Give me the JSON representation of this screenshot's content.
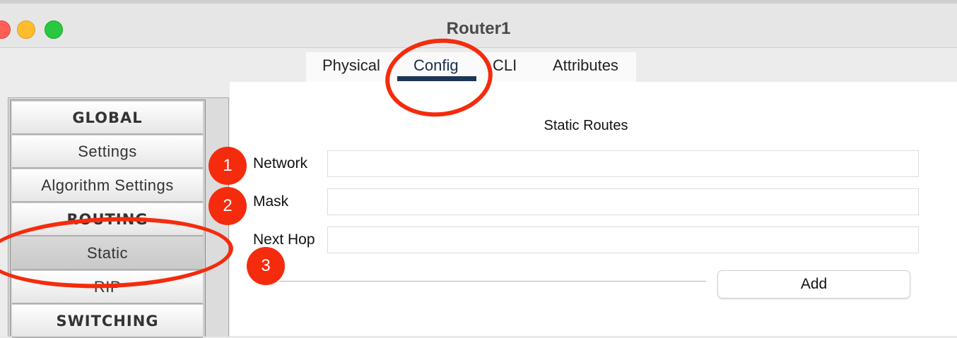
{
  "window": {
    "title": "Router1"
  },
  "tabs": [
    {
      "label": "Physical"
    },
    {
      "label": "Config"
    },
    {
      "label": "CLI"
    },
    {
      "label": "Attributes"
    }
  ],
  "sidebar": {
    "items": [
      {
        "label": "GLOBAL",
        "kind": "header"
      },
      {
        "label": "Settings",
        "kind": "item"
      },
      {
        "label": "Algorithm Settings",
        "kind": "item"
      },
      {
        "label": "ROUTING",
        "kind": "header"
      },
      {
        "label": "Static",
        "kind": "item",
        "selected": true
      },
      {
        "label": "RIP",
        "kind": "item"
      },
      {
        "label": "SWITCHING",
        "kind": "header"
      }
    ]
  },
  "static_routes": {
    "title": "Static Routes",
    "network_label": "Network",
    "network_value": "",
    "mask_label": "Mask",
    "mask_value": "",
    "next_hop_label": "Next Hop",
    "next_hop_value": "",
    "add_label": "Add"
  },
  "annotations": {
    "badges": [
      "1",
      "2",
      "3"
    ],
    "color": "#f52b0d"
  },
  "colors": {
    "tab_underline": "#1d3557",
    "annotation_red": "#f52b0d"
  }
}
